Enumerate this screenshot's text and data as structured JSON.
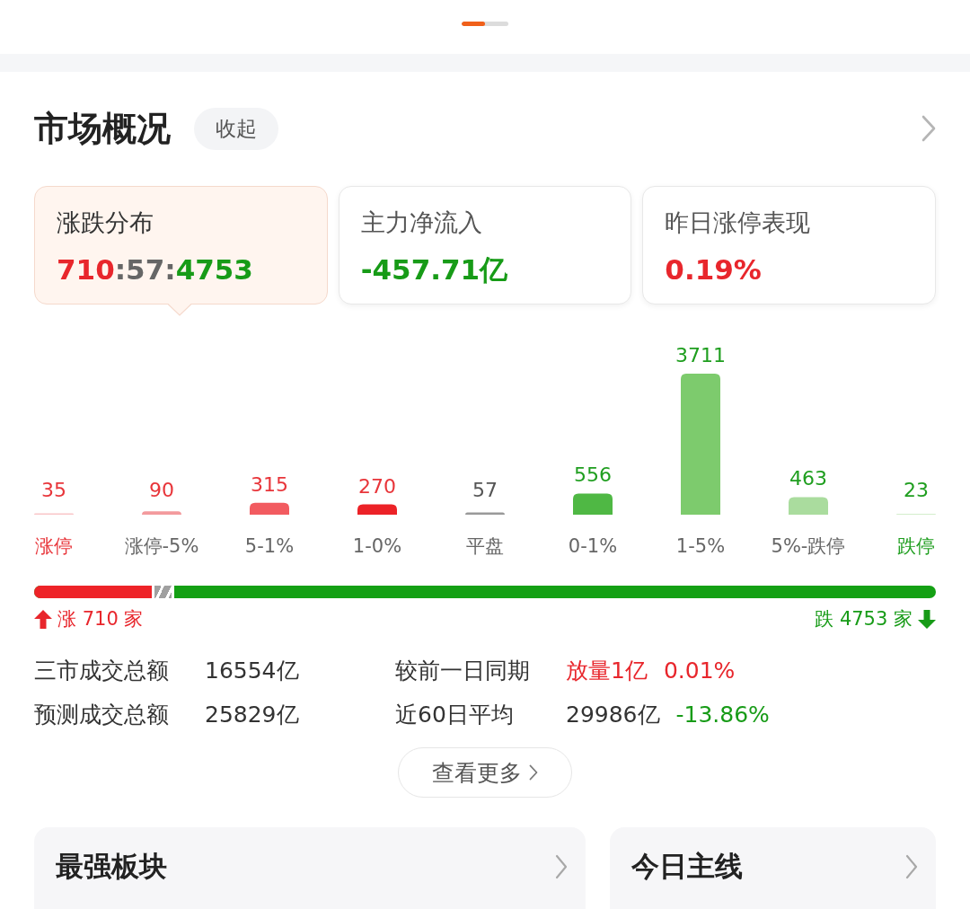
{
  "title": "市场概况",
  "collapse_button": "收起",
  "cards": [
    {
      "title": "涨跌分布",
      "selected": true,
      "value_parts": [
        {
          "text": "710",
          "color": "#e8262c"
        },
        {
          "text": ":57:",
          "color": "#666666"
        },
        {
          "text": "4753",
          "color": "#179b17"
        }
      ]
    },
    {
      "title": "主力净流入",
      "selected": false,
      "value_parts": [
        {
          "text": "-457.71亿",
          "color": "#179b17"
        }
      ]
    },
    {
      "title": "昨日涨停表现",
      "selected": false,
      "value_parts": [
        {
          "text": "0.19%",
          "color": "#e8262c"
        }
      ]
    }
  ],
  "distribution": {
    "chart_data": {
      "type": "bar",
      "categories": [
        "涨停",
        "涨停-5%",
        "5-1%",
        "1-0%",
        "平盘",
        "0-1%",
        "1-5%",
        "5%-跌停",
        "跌停"
      ],
      "values": [
        35,
        90,
        315,
        270,
        57,
        556,
        3711,
        463,
        23
      ],
      "data_labels": true
    },
    "bars": [
      {
        "color": "#f9c6c8",
        "kind": "up",
        "emphasized": true
      },
      {
        "color": "#f39a9d",
        "kind": "up",
        "emphasized": false
      },
      {
        "color": "#f25b60",
        "kind": "up",
        "emphasized": false
      },
      {
        "color": "#ec2227",
        "kind": "up",
        "emphasized": false
      },
      {
        "color": "#999999",
        "kind": "flat",
        "emphasized": false
      },
      {
        "color": "#4fb844",
        "kind": "down",
        "emphasized": false
      },
      {
        "color": "#7dcb6d",
        "kind": "down",
        "emphasized": false
      },
      {
        "color": "#aadc9e",
        "kind": "down",
        "emphasized": false
      },
      {
        "color": "#d3eecc",
        "kind": "down",
        "emphasized": true
      }
    ]
  },
  "breadth": {
    "level": 0.155,
    "up_label": "涨 710 家",
    "down_label": "跌 4753 家"
  },
  "stats": [
    {
      "label": "三市成交总额",
      "values": [
        {
          "text": "16554亿",
          "color": "#333333"
        }
      ]
    },
    {
      "label": "较前一日同期",
      "values": [
        {
          "text": "放量1亿",
          "color": "#e8262c"
        },
        {
          "text": "0.01%",
          "color": "#e8262c"
        }
      ]
    },
    {
      "label": "预测成交总额",
      "values": [
        {
          "text": "25829亿",
          "color": "#333333"
        }
      ]
    },
    {
      "label": "近60日平均",
      "values": [
        {
          "text": "29986亿",
          "color": "#333333"
        },
        {
          "text": "-13.86%",
          "color": "#179b17"
        }
      ]
    }
  ],
  "more_button": "查看更多",
  "sections": [
    {
      "title": "最强板块"
    },
    {
      "title": "今日主线"
    }
  ]
}
